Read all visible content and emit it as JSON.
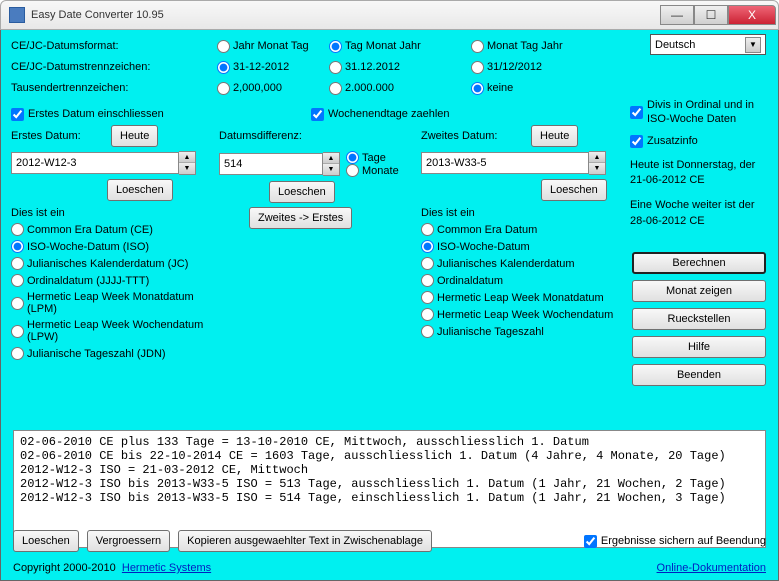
{
  "title": "Easy Date Converter 10.95",
  "win": {
    "min": "—",
    "max": "☐",
    "close": "X"
  },
  "lang": "Deutsch",
  "fmt": {
    "label": "CE/JC-Datumsformat:",
    "opts": [
      "Jahr Monat Tag",
      "Tag Monat Jahr",
      "Monat Tag Jahr"
    ]
  },
  "sep": {
    "label": "CE/JC-Datumstrennzeichen:",
    "opts": [
      "31-12-2012",
      "31.12.2012",
      "31/12/2012"
    ]
  },
  "tsep": {
    "label": "Tausendertrennzeichen:",
    "opts": [
      "2,000,000",
      "2.000.000",
      "keine"
    ]
  },
  "incFirst": "Erstes Datum einschliessen",
  "incWeekend": "Wochenendtage zaehlen",
  "divis": "Divis in Ordinal und in ISO-Woche Daten",
  "zusatz": "Zusatzinfo",
  "today_info": "Heute ist Donnerstag, der 21-06-2012 CE",
  "week_info": "Eine Woche weiter ist der 28-06-2012 CE",
  "d1": {
    "label": "Erstes Datum:",
    "heute": "Heute",
    "val": "2012-W12-3",
    "clear": "Loeschen",
    "hdr": "Dies ist ein"
  },
  "diff": {
    "label": "Datumsdifferenz:",
    "val": "514",
    "tage": "Tage",
    "monate": "Monate",
    "clear": "Loeschen",
    "swap": "Zweites -> Erstes"
  },
  "d2": {
    "label": "Zweites Datum:",
    "heute": "Heute",
    "val": "2013-W33-5",
    "clear": "Loeschen",
    "hdr": "Dies ist ein"
  },
  "types1": [
    "Common Era Datum (CE)",
    "ISO-Woche-Datum (ISO)",
    "Julianisches Kalenderdatum (JC)",
    "Ordinaldatum (JJJJ-TTT)",
    "Hermetic Leap Week Monatdatum (LPM)",
    "Hermetic Leap Week Wochendatum (LPW)",
    "Julianische Tageszahl (JDN)"
  ],
  "types2": [
    "Common Era Datum",
    "ISO-Woche-Datum",
    "Julianisches Kalenderdatum",
    "Ordinaldatum",
    "Hermetic Leap Week Monatdatum",
    "Hermetic Leap Week Wochendatum",
    "Julianische Tageszahl"
  ],
  "rbtns": [
    "Berechnen",
    "Monat zeigen",
    "Rueckstellen",
    "Hilfe",
    "Beenden"
  ],
  "log": "02-06-2010 CE plus 133 Tage = 13-10-2010 CE, Mittwoch, ausschliesslich 1. Datum\n02-06-2010 CE bis 22-10-2014 CE = 1603 Tage, ausschliesslich 1. Datum (4 Jahre, 4 Monate, 20 Tage)\n2012-W12-3 ISO = 21-03-2012 CE, Mittwoch\n2012-W12-3 ISO bis 2013-W33-5 ISO = 513 Tage, ausschliesslich 1. Datum (1 Jahr, 21 Wochen, 2 Tage)\n2012-W12-3 ISO bis 2013-W33-5 ISO = 514 Tage, einschliesslich 1. Datum (1 Jahr, 21 Wochen, 3 Tage)",
  "bottom": {
    "clear": "Loeschen",
    "enlarge": "Vergroessern",
    "copy": "Kopieren ausgewaehlter Text in Zwischenablage",
    "save": "Ergebnisse sichern auf Beendung"
  },
  "footer": {
    "copy": "Copyright 2000-2010",
    "herm": "Hermetic Systems",
    "doc": "Online-Dokumentation"
  }
}
